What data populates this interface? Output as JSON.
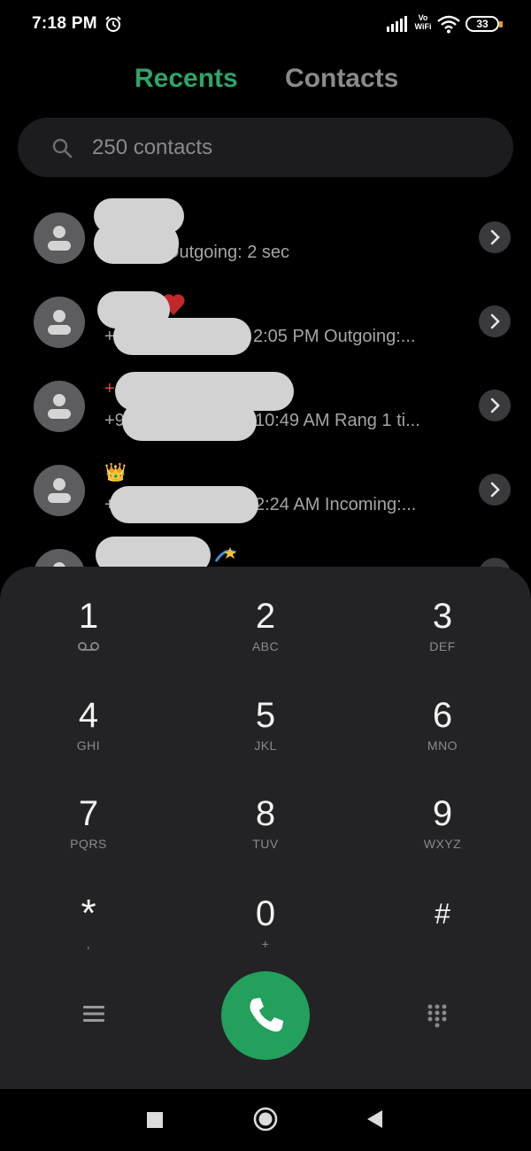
{
  "status": {
    "time": "7:18 PM",
    "volte_top": "Vo",
    "volte_bottom": "WiFi",
    "battery": "33"
  },
  "tabs": [
    {
      "label": "Recents",
      "active": true
    },
    {
      "label": "Contacts",
      "active": false
    }
  ],
  "search": {
    "placeholder": "250 contacts"
  },
  "recents": [
    {
      "name_prefix": "",
      "detail_prefix": "",
      "detail": ":55 PM Outgoing: 2 sec"
    },
    {
      "name_prefix": "",
      "detail_prefix": "+",
      "detail": "2:05 PM Outgoing:..."
    },
    {
      "name_prefix": "+",
      "detail_prefix": "+9",
      "detail": "10:49 AM Rang 1 ti..."
    },
    {
      "name_prefix": "👑",
      "detail_prefix": "+",
      "detail": "2:24 AM Incoming:..."
    },
    {
      "name_prefix": "",
      "detail_prefix": "",
      "detail": ""
    }
  ],
  "dialpad": {
    "keys": [
      {
        "num": "1",
        "letters": ""
      },
      {
        "num": "2",
        "letters": "ABC"
      },
      {
        "num": "3",
        "letters": "DEF"
      },
      {
        "num": "4",
        "letters": "GHI"
      },
      {
        "num": "5",
        "letters": "JKL"
      },
      {
        "num": "6",
        "letters": "MNO"
      },
      {
        "num": "7",
        "letters": "PQRS"
      },
      {
        "num": "8",
        "letters": "TUV"
      },
      {
        "num": "9",
        "letters": "WXYZ"
      },
      {
        "num": "*",
        "letters": ","
      },
      {
        "num": "0",
        "letters": "+"
      },
      {
        "num": "#",
        "letters": ""
      }
    ]
  },
  "colors": {
    "accent": "#2fa566",
    "call_button": "#22a05c",
    "dialpad_bg": "#232325"
  }
}
